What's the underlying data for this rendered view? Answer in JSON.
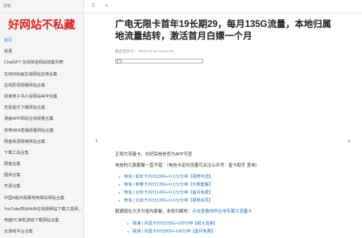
{
  "sidebar": {
    "search_label": "搜索",
    "logo": "好网站不私藏",
    "items": [
      "首页",
      "资源",
      "ChatGPT 在线体验网站收集列表",
      "在线AI绘画生成网站应用合集",
      "在线影视观看网站合集",
      "阅读电子书小说网站APP合集",
      "无损音乐下载网站合集",
      "漫画APP网站在线观看合集",
      "体育NBA直播观看网站合集",
      "网盘资源搜索网站合集",
      "下载工具合集",
      "网盘合集",
      "图床合集",
      "开源合集",
      "中国A股炒股票常用相关网站合集",
      "YouTube类似4k存在线视频站下载工具网…",
      "电脑PC单机游戏下载网站合集",
      "云游戏平台合集"
    ]
  },
  "topbar": {
    "menu_icon_label": "☰",
    "font_label": "A"
  },
  "article": {
    "title": "广电无限卡首年19长期29，每月135G流量，本地归属地流量结转，激活首月白嫖一个月",
    "meta": "最后更新于：2023-02-04 16:55:49",
    "p1": "正规大流量卡，办好后电信官方APP可查",
    "p2": "电信的几款套餐一直不错：（电信卡定向流量可关注公众号：星卡助手 查询）",
    "telecom_items": [
      "电信 | 蛇年卡29元230G+0.1元/分钟【招牌可选】",
      "电信 | 新春卡29元135G+0.1元/分钟【长期套餐】",
      "电信 | 云积卡29元140G+0.1元/分钟【首月免费】",
      "电信 | 云启卡29元130G+0.1元/分钟【视频会员】"
    ],
    "p3_prefix": "联通现在大多为省内套餐，本省归属地：",
    "p3_link": "点击查看你所在地专属大流量卡",
    "unicom_items": [
      "联通 | 凤凰卡29元155G+100分钟【超大流量】",
      "联通 | 凤凰卡29元80G+100分钟【首月免费】"
    ]
  },
  "nav": {
    "prev": "‹",
    "next": "›"
  },
  "colors": {
    "logo": "#e02020",
    "link": "#1e73be",
    "active": "#1e88e5"
  }
}
